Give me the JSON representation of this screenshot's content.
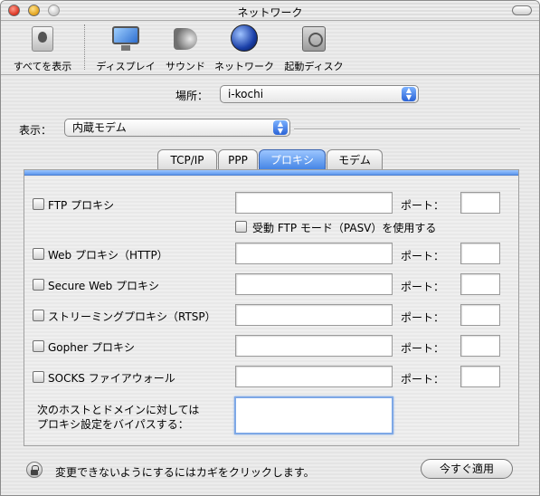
{
  "window": {
    "title": "ネットワーク"
  },
  "toolbar": {
    "items": [
      {
        "label": "すべてを表示",
        "icon": "apple-logo-icon"
      },
      {
        "label": "ディスプレイ",
        "icon": "monitor-icon"
      },
      {
        "label": "サウンド",
        "icon": "speaker-icon"
      },
      {
        "label": "ネットワーク",
        "icon": "globe-icon"
      },
      {
        "label": "起動ディスク",
        "icon": "hard-disk-icon"
      }
    ]
  },
  "location": {
    "label": "場所：",
    "value": "i-kochi"
  },
  "show": {
    "label": "表示：",
    "value": "内蔵モデム"
  },
  "tabs": [
    {
      "label": "TCP/IP",
      "active": false
    },
    {
      "label": "PPP",
      "active": false
    },
    {
      "label": "プロキシ",
      "active": true
    },
    {
      "label": "モデム",
      "active": false
    }
  ],
  "proxies": {
    "port_label": "ポート：",
    "rows": [
      {
        "label": "FTP プロキシ",
        "checked": false,
        "server": "",
        "port": ""
      },
      {
        "label": "Web プロキシ（HTTP）",
        "checked": false,
        "server": "",
        "port": ""
      },
      {
        "label": "Secure Web プロキシ",
        "checked": false,
        "server": "",
        "port": ""
      },
      {
        "label": "ストリーミングプロキシ（RTSP）",
        "checked": false,
        "server": "",
        "port": ""
      },
      {
        "label": "Gopher プロキシ",
        "checked": false,
        "server": "",
        "port": ""
      },
      {
        "label": "SOCKS ファイアウォール",
        "checked": false,
        "server": "",
        "port": ""
      }
    ],
    "passive_ftp": {
      "label": "受動 FTP モード（PASV）を使用する",
      "checked": false
    },
    "bypass": {
      "line1": "次のホストとドメインに対しては",
      "line2": "プロキシ設定をバイパスする：",
      "value": ""
    }
  },
  "footer": {
    "lock_text": "変更できないようにするにはカギをクリックします。",
    "apply_label": "今すぐ適用"
  },
  "colors": {
    "accent": "#3d7fe3",
    "focus": "#7ea8e6"
  }
}
